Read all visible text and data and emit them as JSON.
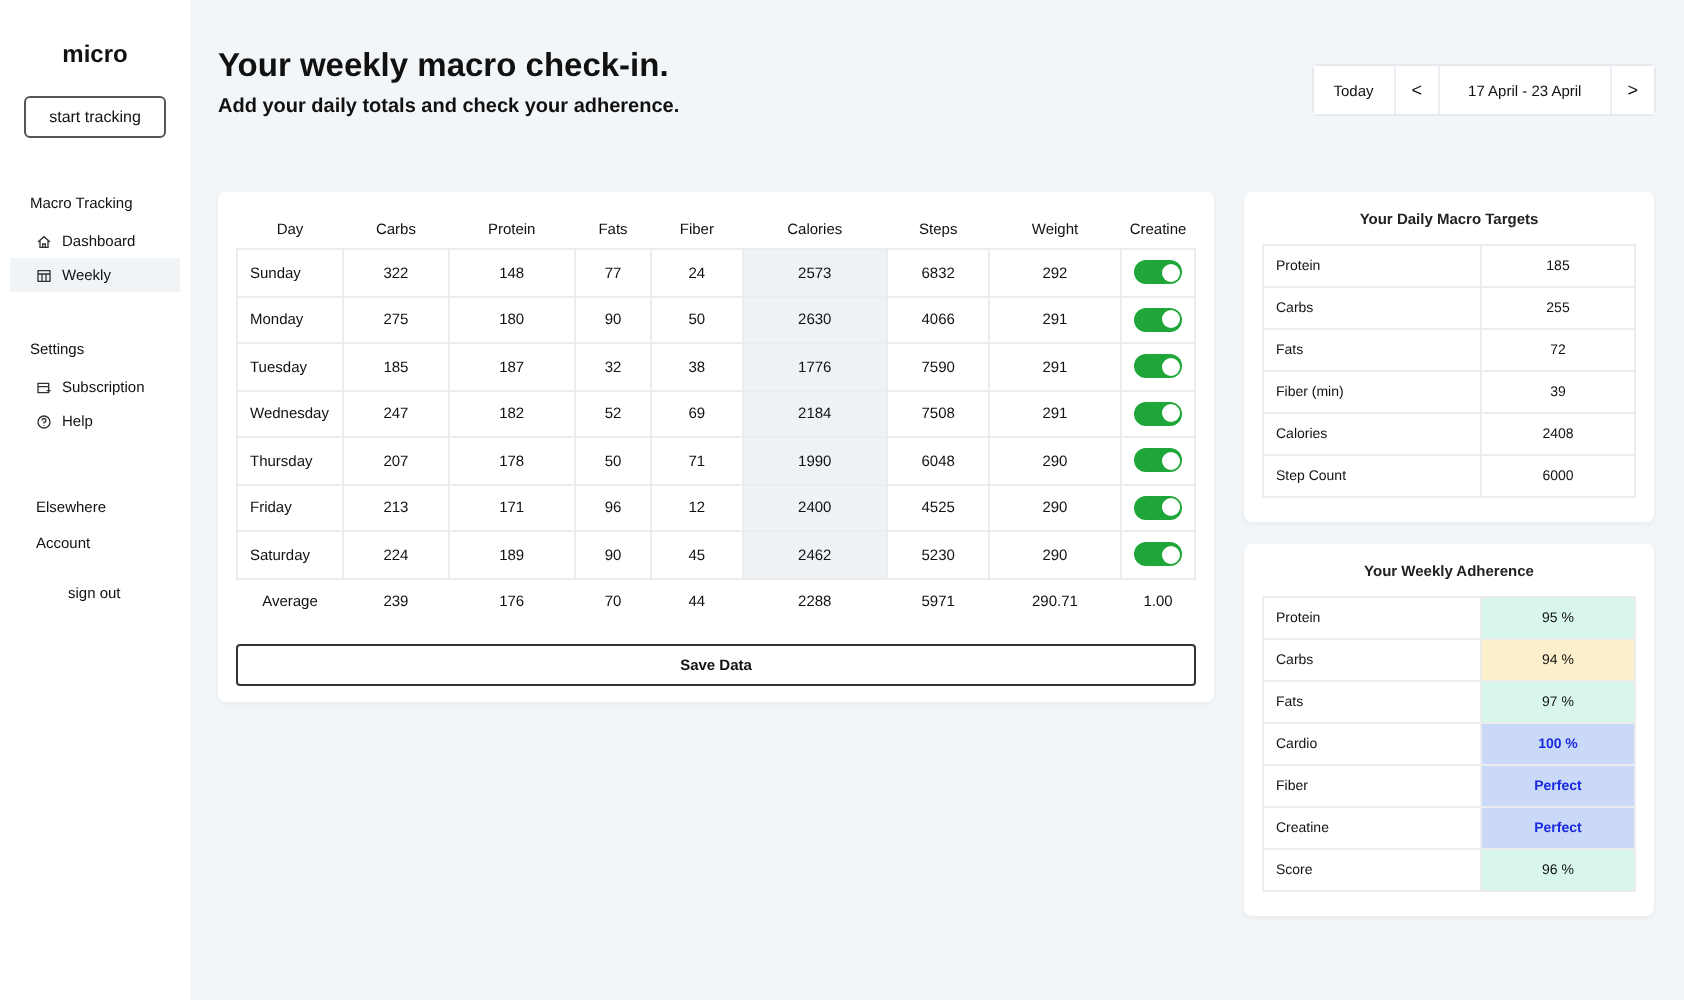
{
  "sidebar": {
    "logo": "micro",
    "start_button": "start tracking",
    "sections": [
      {
        "title": "Macro Tracking",
        "items": [
          {
            "label": "Dashboard",
            "selected": false
          },
          {
            "label": "Weekly",
            "selected": true
          }
        ]
      },
      {
        "title": "Settings",
        "items": [
          {
            "label": "Subscription",
            "selected": false
          },
          {
            "label": "Help",
            "selected": false
          }
        ]
      }
    ],
    "elsewhere": {
      "title": "Elsewhere",
      "account": "Account",
      "sign_out": "sign out"
    }
  },
  "header": {
    "title": "Your weekly macro check-in.",
    "subtitle": "Add your daily totals and check your adherence.",
    "today": "Today",
    "prev": "<",
    "range": "17 April - 23 April",
    "next": ">"
  },
  "table": {
    "columns": [
      "Day",
      "Carbs",
      "Protein",
      "Fats",
      "Fiber",
      "Calories",
      "Steps",
      "Weight",
      "Creatine"
    ],
    "calories_column_highlighted": true,
    "rows": [
      {
        "cells": [
          "Sunday",
          "322",
          "148",
          "77",
          "24",
          "2573",
          "6832",
          "292"
        ],
        "creatine": true
      },
      {
        "cells": [
          "Monday",
          "275",
          "180",
          "90",
          "50",
          "2630",
          "4066",
          "291"
        ],
        "creatine": true
      },
      {
        "cells": [
          "Tuesday",
          "185",
          "187",
          "32",
          "38",
          "1776",
          "7590",
          "291"
        ],
        "creatine": true
      },
      {
        "cells": [
          "Wednesday",
          "247",
          "182",
          "52",
          "69",
          "2184",
          "7508",
          "291"
        ],
        "creatine": true
      },
      {
        "cells": [
          "Thursday",
          "207",
          "178",
          "50",
          "71",
          "1990",
          "6048",
          "290"
        ],
        "creatine": true
      },
      {
        "cells": [
          "Friday",
          "213",
          "171",
          "96",
          "12",
          "2400",
          "4525",
          "290"
        ],
        "creatine": true
      },
      {
        "cells": [
          "Saturday",
          "224",
          "189",
          "90",
          "45",
          "2462",
          "5230",
          "290"
        ],
        "creatine": true
      }
    ],
    "average": [
      "Average",
      "239",
      "176",
      "70",
      "44",
      "2288",
      "5971",
      "290.71",
      "1.00"
    ],
    "save_button": "Save Data"
  },
  "targets": {
    "title": "Your Daily Macro Targets",
    "rows": [
      {
        "label": "Protein",
        "value": "185"
      },
      {
        "label": "Carbs",
        "value": "255"
      },
      {
        "label": "Fats",
        "value": "72"
      },
      {
        "label": "Fiber (min)",
        "value": "39"
      },
      {
        "label": "Calories",
        "value": "2408"
      },
      {
        "label": "Step Count",
        "value": "6000"
      }
    ]
  },
  "adherence": {
    "title": "Your Weekly Adherence",
    "rows": [
      {
        "label": "Protein",
        "value": "95 %",
        "kind": "good"
      },
      {
        "label": "Carbs",
        "value": "94 %",
        "kind": "warn"
      },
      {
        "label": "Fats",
        "value": "97 %",
        "kind": "good"
      },
      {
        "label": "Cardio",
        "value": "100 %",
        "kind": "perfect"
      },
      {
        "label": "Fiber",
        "value": "Perfect",
        "kind": "perfect"
      },
      {
        "label": "Creatine",
        "value": "Perfect",
        "kind": "perfect"
      },
      {
        "label": "Score",
        "value": "96 %",
        "kind": "good"
      }
    ]
  }
}
